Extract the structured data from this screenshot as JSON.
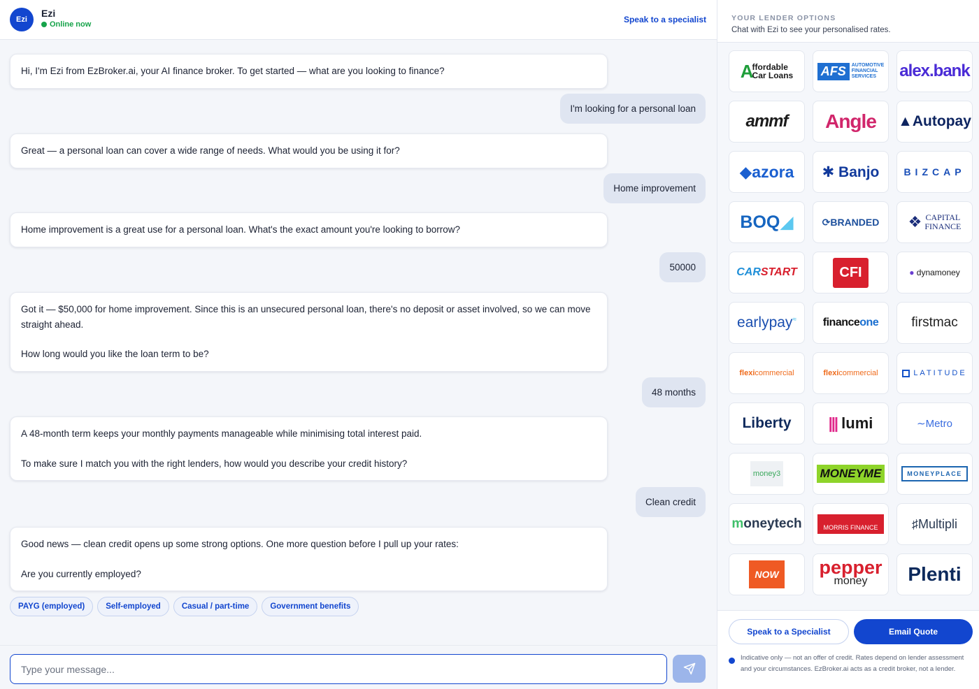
{
  "header": {
    "avatar_initials": "Ezi",
    "agent_name": "Ezi",
    "status": "Online now",
    "specialist_link": "Speak to a specialist"
  },
  "messages": [
    {
      "role": "bot",
      "paragraphs": [
        "Hi, I'm Ezi from EzBroker.ai, your AI finance broker. To get started — what are you looking to finance?"
      ]
    },
    {
      "role": "user",
      "text": "I'm looking for a personal loan"
    },
    {
      "role": "bot",
      "paragraphs": [
        "Great — a personal loan can cover a wide range of needs. What would you be using it for?"
      ]
    },
    {
      "role": "user",
      "text": "Home improvement"
    },
    {
      "role": "bot",
      "paragraphs": [
        "Home improvement is a great use for a personal loan. What's the exact amount you're looking to borrow?"
      ]
    },
    {
      "role": "user",
      "text": "50000"
    },
    {
      "role": "bot",
      "paragraphs": [
        "Got it — $50,000 for home improvement. Since this is an unsecured personal loan, there's no deposit or asset involved, so we can move straight ahead.",
        "How long would you like the loan term to be?"
      ]
    },
    {
      "role": "user",
      "text": "48 months"
    },
    {
      "role": "bot",
      "paragraphs": [
        "A 48-month term keeps your monthly payments manageable while minimising total interest paid.",
        "To make sure I match you with the right lenders, how would you describe your credit history?"
      ]
    },
    {
      "role": "user",
      "text": "Clean credit"
    },
    {
      "role": "bot",
      "paragraphs": [
        "Good news — clean credit opens up some strong options. One more question before I pull up your rates:",
        "Are you currently employed?"
      ]
    }
  ],
  "quick_replies": [
    "PAYG (employed)",
    "Self-employed",
    "Casual / part-time",
    "Government benefits"
  ],
  "composer": {
    "placeholder": "Type your message...",
    "send_icon": "send-icon"
  },
  "sidebar": {
    "kicker": "YOUR LENDER OPTIONS",
    "subtitle": "Chat with Ezi to see your personalised rates.",
    "lenders": [
      {
        "id": "affordable-car-loans",
        "name": "Affordable Car Loans",
        "color": "#1f9e3a"
      },
      {
        "id": "afs",
        "name": "AFS Automotive Financial Services",
        "color": "#1f6fd1"
      },
      {
        "id": "alex-bank",
        "name": "alex.bank",
        "color": "#4a2bd6"
      },
      {
        "id": "ammf",
        "name": "ammf",
        "color": "#1c1c1c"
      },
      {
        "id": "angle",
        "name": "Angle Finance",
        "color": "#d1266b"
      },
      {
        "id": "autopay",
        "name": "Autopay",
        "color": "#0d2460"
      },
      {
        "id": "azora",
        "name": "azora",
        "color": "#1a5fd0"
      },
      {
        "id": "banjo",
        "name": "Banjo",
        "color": "#123a9c"
      },
      {
        "id": "bizcap",
        "name": "BIZCAP",
        "color": "#1a4fb8"
      },
      {
        "id": "boq",
        "name": "BOQ",
        "color": "#1665c0"
      },
      {
        "id": "branded",
        "name": "Branded Financial Services",
        "color": "#1c4f9c"
      },
      {
        "id": "capital-finance",
        "name": "Capital Finance",
        "color": "#1a2d7a"
      },
      {
        "id": "carstart",
        "name": "CarStart",
        "color": "#1f8fd8"
      },
      {
        "id": "cfi",
        "name": "CFI",
        "color": "#d8202e"
      },
      {
        "id": "dynamoney",
        "name": "dynamoney",
        "color": "#6a3fd1"
      },
      {
        "id": "earlypay",
        "name": "earlypay",
        "color": "#1b4fb0"
      },
      {
        "id": "financeone",
        "name": "financeone",
        "color": "#111111"
      },
      {
        "id": "firstmac",
        "name": "firstmac",
        "color": "#222222"
      },
      {
        "id": "flexicommercial-1",
        "name": "flexicommercial",
        "color": "#ef6a1a"
      },
      {
        "id": "flexicommercial-2",
        "name": "flexicommercial",
        "color": "#ef6a1a"
      },
      {
        "id": "latitude",
        "name": "LATITUDE",
        "color": "#1452c9"
      },
      {
        "id": "liberty",
        "name": "Liberty",
        "color": "#0f2a5c"
      },
      {
        "id": "lumi",
        "name": "lumi",
        "color": "#e0278a"
      },
      {
        "id": "metro",
        "name": "Metro",
        "color": "#3a6de0"
      },
      {
        "id": "money3",
        "name": "money3",
        "color": "#3aa85c"
      },
      {
        "id": "moneyme",
        "name": "MONEYME",
        "color": "#8ed42a"
      },
      {
        "id": "moneyplace",
        "name": "MONEYPLACE",
        "color": "#1c65b0"
      },
      {
        "id": "moneytech",
        "name": "moneytech",
        "color": "#2a3a52"
      },
      {
        "id": "morris-finance",
        "name": "Morris Finance",
        "color": "#d8202e"
      },
      {
        "id": "multipli",
        "name": "Multipli",
        "color": "#2a3a52"
      },
      {
        "id": "now-finance",
        "name": "NOW Finance",
        "color": "#ef5a24"
      },
      {
        "id": "pepper-money",
        "name": "pepper money",
        "color": "#d8202e"
      },
      {
        "id": "plenti",
        "name": "Plenti",
        "color": "#0d2a5c"
      }
    ]
  },
  "footer": {
    "specialist_button": "Speak to a Specialist",
    "email_button": "Email Quote",
    "disclaimer": "Indicative only — not an offer of credit. Rates depend on lender assessment and your circumstances. EzBroker.ai acts as a credit broker, not a lender."
  },
  "colors": {
    "accent": "#1246cf",
    "online": "#16a34a",
    "user_bubble": "#dfe5f1",
    "background": "#f4f6fa"
  }
}
